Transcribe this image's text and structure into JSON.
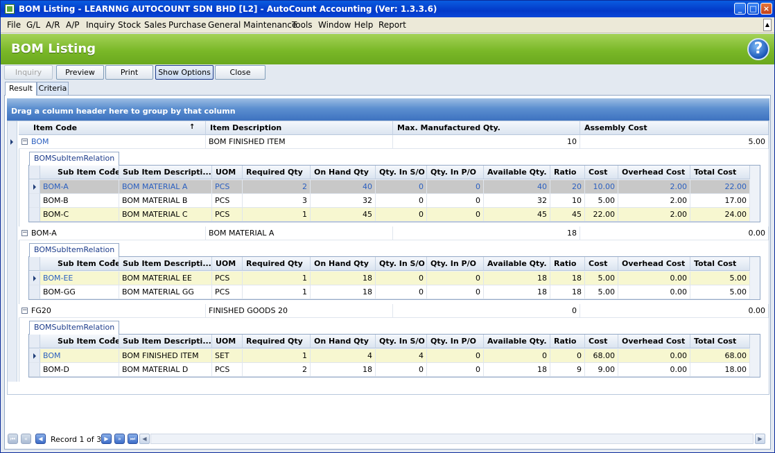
{
  "window": {
    "title": "BOM Listing - LEARNNG AUTOCOUNT SDN BHD [L2] - AutoCount Accounting (Ver: 1.3.3.6)"
  },
  "menu": [
    "File",
    "G/L",
    "A/R",
    "A/P",
    "Inquiry",
    "Stock",
    "Sales",
    "Purchase",
    "General Maintenance",
    "Tools",
    "Window",
    "Help",
    "Report"
  ],
  "header": {
    "title": "BOM Listing"
  },
  "toolbar": {
    "inquiry": "Inquiry",
    "preview": "Preview",
    "print": "Print",
    "show_options": "Show Options",
    "close": "Close"
  },
  "tabs": {
    "result": "Result",
    "criteria": "Criteria"
  },
  "groupbar": "Drag a column header here to group by that column",
  "grid": {
    "columns": [
      "Item Code",
      "Item Description",
      "Max. Manufactured Qty.",
      "Assembly Cost"
    ],
    "detail_tab": "BOMSubItemRelation",
    "detail_columns": [
      "Sub Item Code",
      "Sub Item Descripti...",
      "UOM",
      "Required Qty",
      "On Hand Qty",
      "Qty. In S/O",
      "Qty. In P/O",
      "Available Qty.",
      "Ratio",
      "Cost",
      "Overhead Cost",
      "Total Cost"
    ],
    "rows": [
      {
        "code": "BOM",
        "desc": "BOM FINISHED ITEM",
        "max": "10",
        "cost": "5.00",
        "items": [
          [
            "BOM-A",
            "BOM MATERIAL A",
            "PCS",
            "2",
            "40",
            "0",
            "0",
            "40",
            "20",
            "10.00",
            "2.00",
            "22.00"
          ],
          [
            "BOM-B",
            "BOM MATERIAL B",
            "PCS",
            "3",
            "32",
            "0",
            "0",
            "32",
            "10",
            "5.00",
            "2.00",
            "17.00"
          ],
          [
            "BOM-C",
            "BOM MATERIAL C",
            "PCS",
            "1",
            "45",
            "0",
            "0",
            "45",
            "45",
            "22.00",
            "2.00",
            "24.00"
          ]
        ]
      },
      {
        "code": "BOM-A",
        "desc": "BOM MATERIAL A",
        "max": "18",
        "cost": "0.00",
        "items": [
          [
            "BOM-EE",
            "BOM MATERIAL EE",
            "PCS",
            "1",
            "18",
            "0",
            "0",
            "18",
            "18",
            "5.00",
            "0.00",
            "5.00"
          ],
          [
            "BOM-GG",
            "BOM MATERIAL GG",
            "PCS",
            "1",
            "18",
            "0",
            "0",
            "18",
            "18",
            "5.00",
            "0.00",
            "5.00"
          ]
        ]
      },
      {
        "code": "FG20",
        "desc": "FINISHED GOODS 20",
        "max": "0",
        "cost": "0.00",
        "items": [
          [
            "BOM",
            "BOM FINISHED ITEM",
            "SET",
            "1",
            "4",
            "4",
            "0",
            "0",
            "0",
            "68.00",
            "0.00",
            "68.00"
          ],
          [
            "BOM-D",
            "BOM MATERIAL D",
            "PCS",
            "2",
            "18",
            "0",
            "0",
            "18",
            "9",
            "9.00",
            "0.00",
            "18.00"
          ]
        ]
      }
    ]
  },
  "navigator": {
    "record_text": "Record 1 of 3"
  },
  "colors": {
    "accent_green": "#7ab828",
    "title_blue": "#0339c8",
    "link_blue": "#2a5fc0",
    "highlight_row": "#f7f7d0",
    "selected_row": "#c8c8c8"
  }
}
